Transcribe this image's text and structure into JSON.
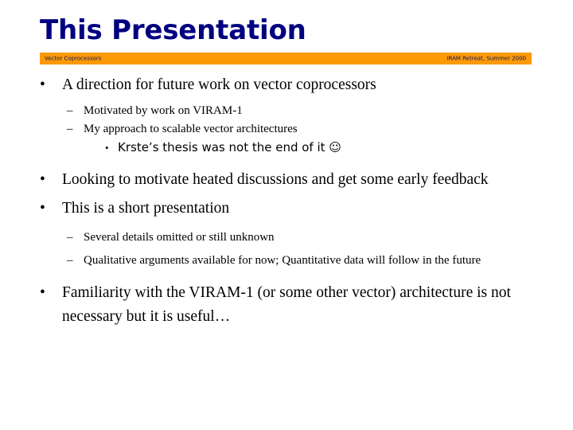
{
  "slide": {
    "title": "This Presentation",
    "banner": {
      "left_label": "Vector Coprocessors",
      "right_label": "IRAM Retreat, Summer 2000",
      "background_color": "#FB9A06",
      "text_color": "#101060"
    },
    "title_color": "#000080",
    "body_text_color": "#000000",
    "background_color": "#FFFFFF",
    "bullet_glyphs": {
      "level1": "•",
      "level2": "–",
      "level3": "•"
    },
    "outline": [
      {
        "level": 1,
        "text": "A direction for future work on vector coprocessors"
      },
      {
        "level": 2,
        "text": "Motivated by work on VIRAM-1"
      },
      {
        "level": 2,
        "text": "My approach to scalable vector architectures"
      },
      {
        "level": 3,
        "text": "Krste’s thesis was not the end of it ☺"
      },
      {
        "level": 1,
        "text": "Looking to motivate heated discussions and get some early feedback"
      },
      {
        "level": 1,
        "text": "This is a short presentation"
      },
      {
        "level": 2,
        "text": "Several details omitted or still unknown"
      },
      {
        "level": 2,
        "text": "Qualitative arguments available for now; Quantitative data will follow in the future"
      },
      {
        "level": 1,
        "text": "Familiarity with the VIRAM-1 (or some other vector) architecture is not necessary but it is useful…"
      }
    ]
  }
}
